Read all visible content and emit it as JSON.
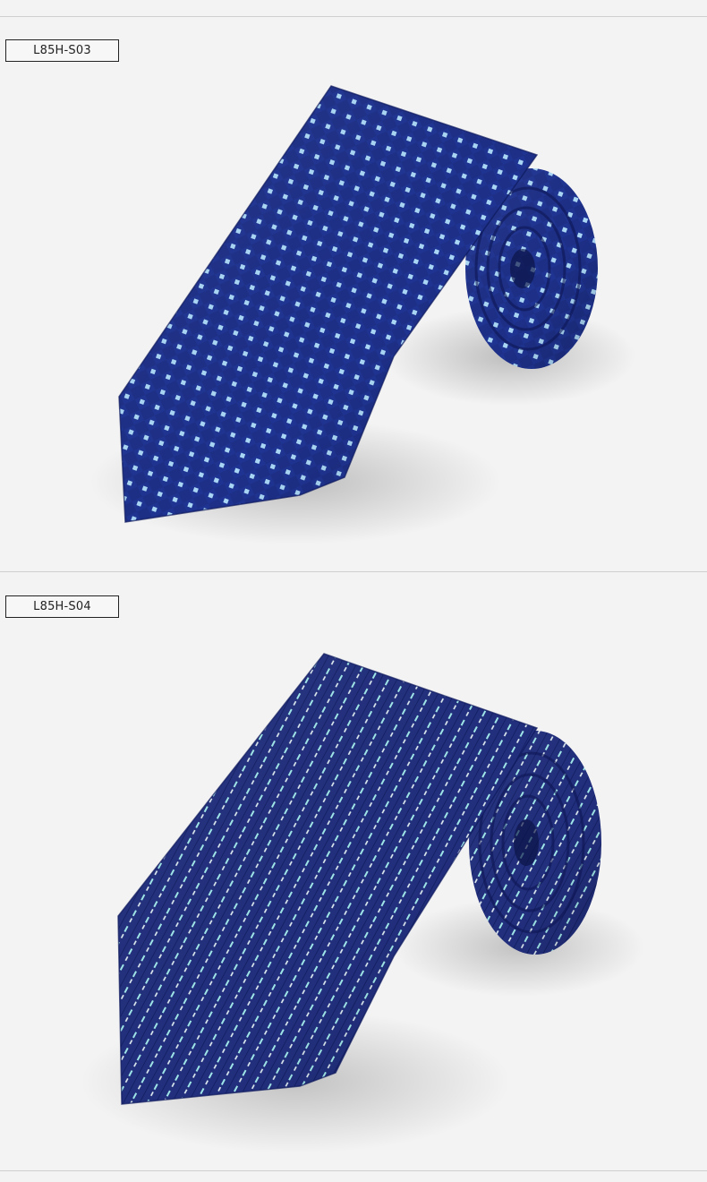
{
  "products": [
    {
      "code": "L85H-S03",
      "pattern": "dot",
      "colors": {
        "base": "#1d2f86",
        "accent": "#a9d6f5"
      }
    },
    {
      "code": "L85H-S04",
      "pattern": "dash",
      "colors": {
        "base": "#222f7d",
        "accent": "#9fe6e8"
      }
    }
  ]
}
